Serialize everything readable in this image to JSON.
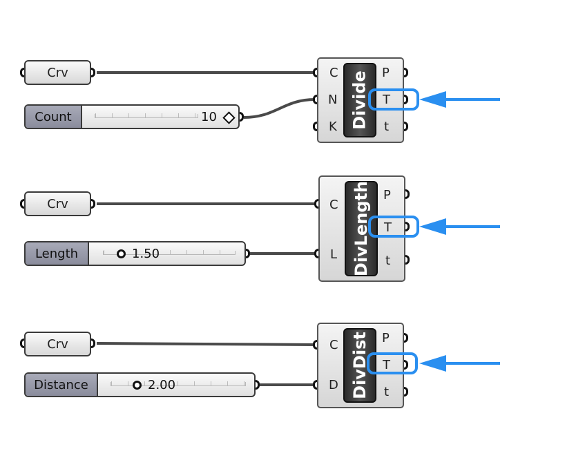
{
  "colors": {
    "highlight": "#2a8ff0",
    "wire": "#4a4a4a",
    "label_fill": "#9a9cab"
  },
  "groups": [
    {
      "curve_param": {
        "label": "Crv"
      },
      "slider": {
        "label": "Count",
        "value": "10",
        "value_icon": "diamond-icon",
        "fraction": 1.0
      },
      "component": {
        "name": "Divide",
        "inputs": [
          "C",
          "N",
          "K"
        ],
        "outputs": [
          "P",
          "T",
          "t"
        ],
        "highlighted_output": "T"
      }
    },
    {
      "curve_param": {
        "label": "Crv"
      },
      "slider": {
        "label": "Length",
        "value": "1.50",
        "value_icon": "grip-icon",
        "fraction": 0.15
      },
      "component": {
        "name": "DivLength",
        "inputs": [
          "C",
          "L"
        ],
        "outputs": [
          "P",
          "T",
          "t"
        ],
        "highlighted_output": "T"
      }
    },
    {
      "curve_param": {
        "label": "Crv"
      },
      "slider": {
        "label": "Distance",
        "value": "2.00",
        "value_icon": "grip-icon",
        "fraction": 0.2
      },
      "component": {
        "name": "DivDist",
        "inputs": [
          "C",
          "D"
        ],
        "outputs": [
          "P",
          "T",
          "t"
        ],
        "highlighted_output": "T"
      }
    }
  ]
}
